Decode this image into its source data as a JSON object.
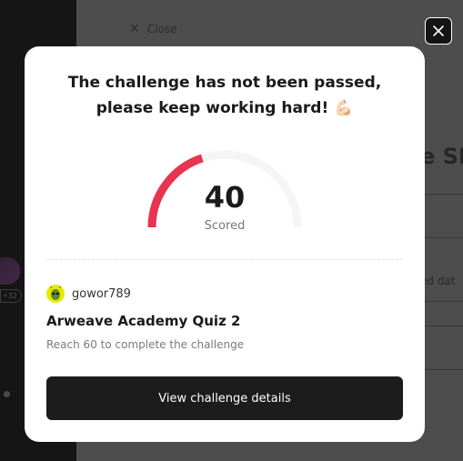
{
  "background": {
    "close_label": "Close",
    "title_fragment": "e SP",
    "table_cell_fragment": "ed dat",
    "avatar_badge": "32"
  },
  "overlay": {
    "close_icon": "close-icon"
  },
  "modal": {
    "heading_line1": "The challenge has not been passed,",
    "heading_line2": "please keep working hard!",
    "heading_emoji": "💪🏻",
    "score": {
      "value": "40",
      "label": "Scored",
      "fraction": 0.4,
      "track_color": "#f5f5f5",
      "progress_color": "#e8344e"
    },
    "user": {
      "name": "gowor789",
      "avatar_icon": "alien-avatar-icon",
      "avatar_color": "#e8e800"
    },
    "quiz": {
      "title": "Arweave Academy Quiz 2",
      "requirement": "Reach 60 to complete the challenge"
    },
    "cta_label": "View challenge details"
  }
}
